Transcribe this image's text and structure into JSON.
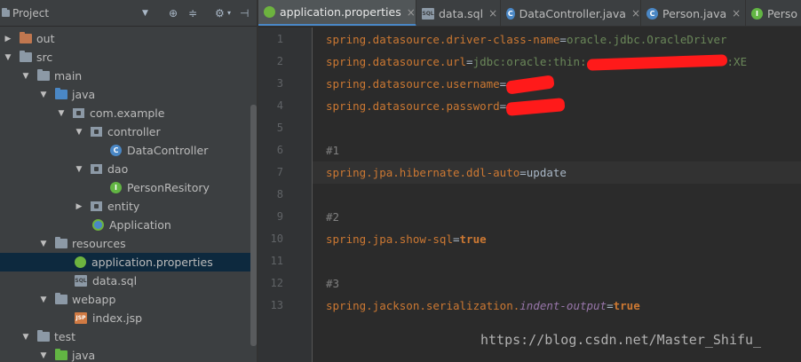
{
  "project_panel": {
    "title": "Project",
    "dropdown_icon": "chevron-down-icon",
    "header_icons": [
      "target-icon",
      "collapse-all-icon",
      "gear-icon",
      "hide-icon"
    ]
  },
  "tree": [
    {
      "label": "out",
      "icon": "folder-orange",
      "expanded": false
    },
    {
      "label": "src",
      "icon": "folder-grey",
      "expanded": true
    },
    {
      "label": "main",
      "icon": "folder-grey",
      "expanded": true
    },
    {
      "label": "java",
      "icon": "folder-blue",
      "expanded": true
    },
    {
      "label": "com.example",
      "icon": "package",
      "expanded": true
    },
    {
      "label": "controller",
      "icon": "package",
      "expanded": true
    },
    {
      "label": "DataController",
      "icon": "class-file"
    },
    {
      "label": "dao",
      "icon": "package",
      "expanded": true
    },
    {
      "label": "PersonResitory",
      "icon": "interface-file"
    },
    {
      "label": "entity",
      "icon": "package",
      "expanded": false
    },
    {
      "label": "Application",
      "icon": "spring-app-file"
    },
    {
      "label": "resources",
      "icon": "folder-resources",
      "expanded": true
    },
    {
      "label": "application.properties",
      "icon": "spring-properties-file",
      "selected": true
    },
    {
      "label": "data.sql",
      "icon": "sql-file"
    },
    {
      "label": "webapp",
      "icon": "folder-grey",
      "expanded": true
    },
    {
      "label": "index.jsp",
      "icon": "jsp-file"
    },
    {
      "label": "test",
      "icon": "folder-grey",
      "expanded": true
    },
    {
      "label": "java",
      "icon": "folder-green",
      "expanded": true
    }
  ],
  "tabs": [
    {
      "label": "application.properties",
      "icon": "spring-properties-file",
      "active": true,
      "close": "×"
    },
    {
      "label": "data.sql",
      "icon": "sql-file",
      "close": "×"
    },
    {
      "label": "DataController.java",
      "icon": "class-file",
      "close": "×"
    },
    {
      "label": "Person.java",
      "icon": "class-file",
      "close": "×"
    },
    {
      "label": "Perso",
      "icon": "interface-file"
    }
  ],
  "editor": {
    "line_numbers": [
      "1",
      "2",
      "3",
      "4",
      "5",
      "6",
      "7",
      "8",
      "9",
      "10",
      "11",
      "12",
      "13"
    ],
    "lines": [
      {
        "key": "spring.datasource.driver-class-name",
        "eq": "=",
        "value": "oracle.jdbc.OracleDriver"
      },
      {
        "key": "spring.datasource.url",
        "eq": "=",
        "value": "jdbc:oracle:thin:",
        "value_tail": ":XE",
        "redacted": true
      },
      {
        "key": "spring.datasource.username",
        "eq": "=",
        "redacted": true
      },
      {
        "key": "spring.datasource.password",
        "eq": "=",
        "redacted": true
      },
      {},
      {
        "comment": "#1"
      },
      {
        "key": "spring.jpa.hibernate.ddl-auto",
        "eq": "=",
        "value": "update",
        "current": true
      },
      {},
      {
        "comment": "#2"
      },
      {
        "key": "spring.jpa.show-sql",
        "eq": "=",
        "value": "true"
      },
      {},
      {
        "comment": "#3"
      },
      {
        "key": "spring.jackson.serialization.",
        "key_italic": "indent-output",
        "eq": "=",
        "value": "true"
      }
    ]
  },
  "watermark": "https://blog.csdn.net/Master_Shifu_",
  "colors": {
    "key": "#cc7832",
    "string_value": "#6a8759",
    "comment": "#808080",
    "italic_key": "#9876aa",
    "selection": "#0d293e",
    "redaction": "#ff1a1a"
  }
}
